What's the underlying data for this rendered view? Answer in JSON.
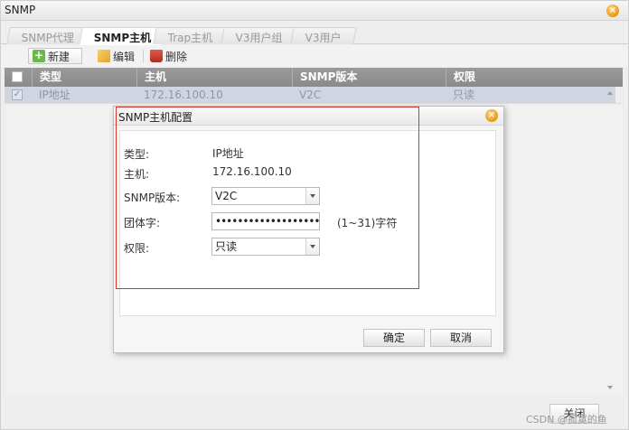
{
  "window": {
    "title": "SNMP",
    "close_icon": "close-icon"
  },
  "tabs": [
    {
      "label": "SNMP代理"
    },
    {
      "label": "SNMP主机"
    },
    {
      "label": "Trap主机"
    },
    {
      "label": "V3用户组"
    },
    {
      "label": "V3用户"
    }
  ],
  "active_tab": "SNMP主机",
  "toolbar": {
    "new_label": "新建",
    "edit_label": "编辑",
    "delete_label": "删除"
  },
  "table": {
    "columns": [
      "类型",
      "主机",
      "SNMP版本",
      "权限"
    ],
    "rows": [
      {
        "checked": true,
        "cells": [
          "IP地址",
          "172.16.100.10",
          "V2C",
          "只读"
        ]
      }
    ]
  },
  "bottom": {
    "close_label": "关闭"
  },
  "watermark": "CSDN @孤寞的鱼",
  "dialog": {
    "title": "SNMP主机配置",
    "type_label": "类型:",
    "type_value": "IP地址",
    "host_label": "主机:",
    "host_value": "172.16.100.10",
    "version_label": "SNMP版本:",
    "version_value": "V2C",
    "community_label": "团体字:",
    "community_value": "••••••••••••••••••••••••",
    "community_hint": "(1~31)字符",
    "permission_label": "权限:",
    "permission_value": "只读",
    "ok_label": "确定",
    "cancel_label": "取消"
  },
  "colors": {
    "highlight_frame": "#d9332b",
    "accent_orange": "#f0a020"
  }
}
